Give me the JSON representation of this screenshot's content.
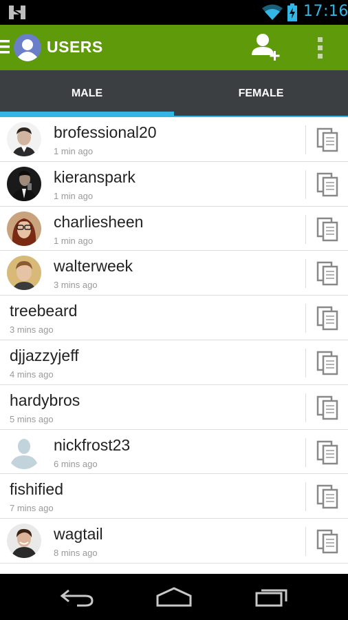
{
  "status_bar": {
    "time": "17:16"
  },
  "action_bar": {
    "title": "USERS"
  },
  "tabs": [
    {
      "label": "MALE",
      "selected": true
    },
    {
      "label": "FEMALE",
      "selected": false
    }
  ],
  "colors": {
    "action_bar": "#5f9a0b",
    "tab_bar": "#3b3f41",
    "accent": "#33b5e5"
  },
  "users": [
    {
      "name": "brofessional20",
      "time": "1 min ago",
      "avatar": "photo-suit-man"
    },
    {
      "name": "kieranspark",
      "time": "1 min ago",
      "avatar": "photo-tuxedo-man"
    },
    {
      "name": "charliesheen",
      "time": "1 min ago",
      "avatar": "photo-woman-glasses"
    },
    {
      "name": "walterweek",
      "time": "3 mins ago",
      "avatar": "photo-young-man"
    },
    {
      "name": "treebeard",
      "time": "3 mins ago",
      "avatar": null
    },
    {
      "name": "djjazzyjeff",
      "time": "4 mins ago",
      "avatar": null
    },
    {
      "name": "hardybros",
      "time": "5 mins ago",
      "avatar": null
    },
    {
      "name": "nickfrost23",
      "time": "6 mins ago",
      "avatar": "default-silhouette"
    },
    {
      "name": "fishified",
      "time": "7 mins ago",
      "avatar": null
    },
    {
      "name": "wagtail",
      "time": "8 mins ago",
      "avatar": "photo-smiling-man"
    }
  ],
  "icons": {
    "menu": "hamburger-icon",
    "profile": "user-avatar-icon",
    "add_user": "add-user-icon",
    "overflow": "overflow-menu-icon",
    "row_action": "copy-icon",
    "nav": [
      "back-icon",
      "home-icon",
      "recents-icon"
    ]
  }
}
